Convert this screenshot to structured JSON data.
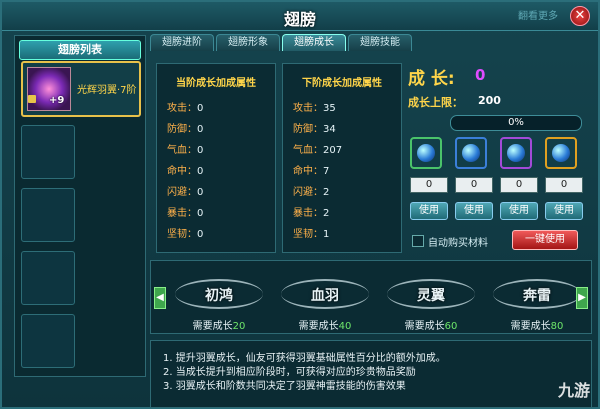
{
  "window": {
    "title": "翅膀",
    "corner_text": "翻看更多",
    "close_symbol": "✕"
  },
  "sidebar": {
    "header": "翅膀列表",
    "active_item": {
      "name": "光辉羽翼·7阶",
      "badge": "+9"
    }
  },
  "tabs": [
    {
      "label": "翅膀进阶"
    },
    {
      "label": "翅膀形象"
    },
    {
      "label": "翅膀成长"
    },
    {
      "label": "翅膀技能"
    }
  ],
  "current": {
    "title": "当阶成长加成属性",
    "stats": [
      {
        "label": "攻击：",
        "value": "0"
      },
      {
        "label": "防御：",
        "value": "0"
      },
      {
        "label": "气血：",
        "value": "0"
      },
      {
        "label": "命中：",
        "value": "0"
      },
      {
        "label": "闪避：",
        "value": "0"
      },
      {
        "label": "暴击：",
        "value": "0"
      },
      {
        "label": "坚韧：",
        "value": "0"
      }
    ]
  },
  "next": {
    "title": "下阶成长加成属性",
    "stats": [
      {
        "label": "攻击：",
        "value": "35"
      },
      {
        "label": "防御：",
        "value": "34"
      },
      {
        "label": "气血：",
        "value": "207"
      },
      {
        "label": "命中：",
        "value": "7"
      },
      {
        "label": "闪避：",
        "value": "2"
      },
      {
        "label": "暴击：",
        "value": "2"
      },
      {
        "label": "坚韧：",
        "value": "1"
      }
    ]
  },
  "growth": {
    "label": "成 长:",
    "value": "0",
    "limit_label": "成长上限：",
    "limit_value": "200",
    "progress_text": "0%",
    "progress_fraction": 0.0
  },
  "items": [
    {
      "count": "0",
      "use": "使用",
      "border": "#4ac36a"
    },
    {
      "count": "0",
      "use": "使用",
      "border": "#3b7fd9"
    },
    {
      "count": "0",
      "use": "使用",
      "border": "#a24ad9"
    },
    {
      "count": "0",
      "use": "使用",
      "border": "#e0a020"
    }
  ],
  "auto_buy_label": "自动购买材料",
  "one_key_label": "一键使用",
  "stages": [
    {
      "name": "初鸿",
      "req_label": "需要成长",
      "req_value": "20"
    },
    {
      "name": "血羽",
      "req_label": "需要成长",
      "req_value": "40"
    },
    {
      "name": "灵翼",
      "req_label": "需要成长",
      "req_value": "60"
    },
    {
      "name": "奔雷",
      "req_label": "需要成长",
      "req_value": "80"
    }
  ],
  "arrows": {
    "left": "◀",
    "right": "▶"
  },
  "tips": [
    "1. 提升羽翼成长，仙友可获得羽翼基础属性百分比的额外加成。",
    "2. 当成长提升到相应阶段时，可获得对应的珍贵物品奖励",
    "3. 羽翼成长和阶数共同决定了羽翼神雷技能的伤害效果"
  ],
  "watermark": "九游"
}
